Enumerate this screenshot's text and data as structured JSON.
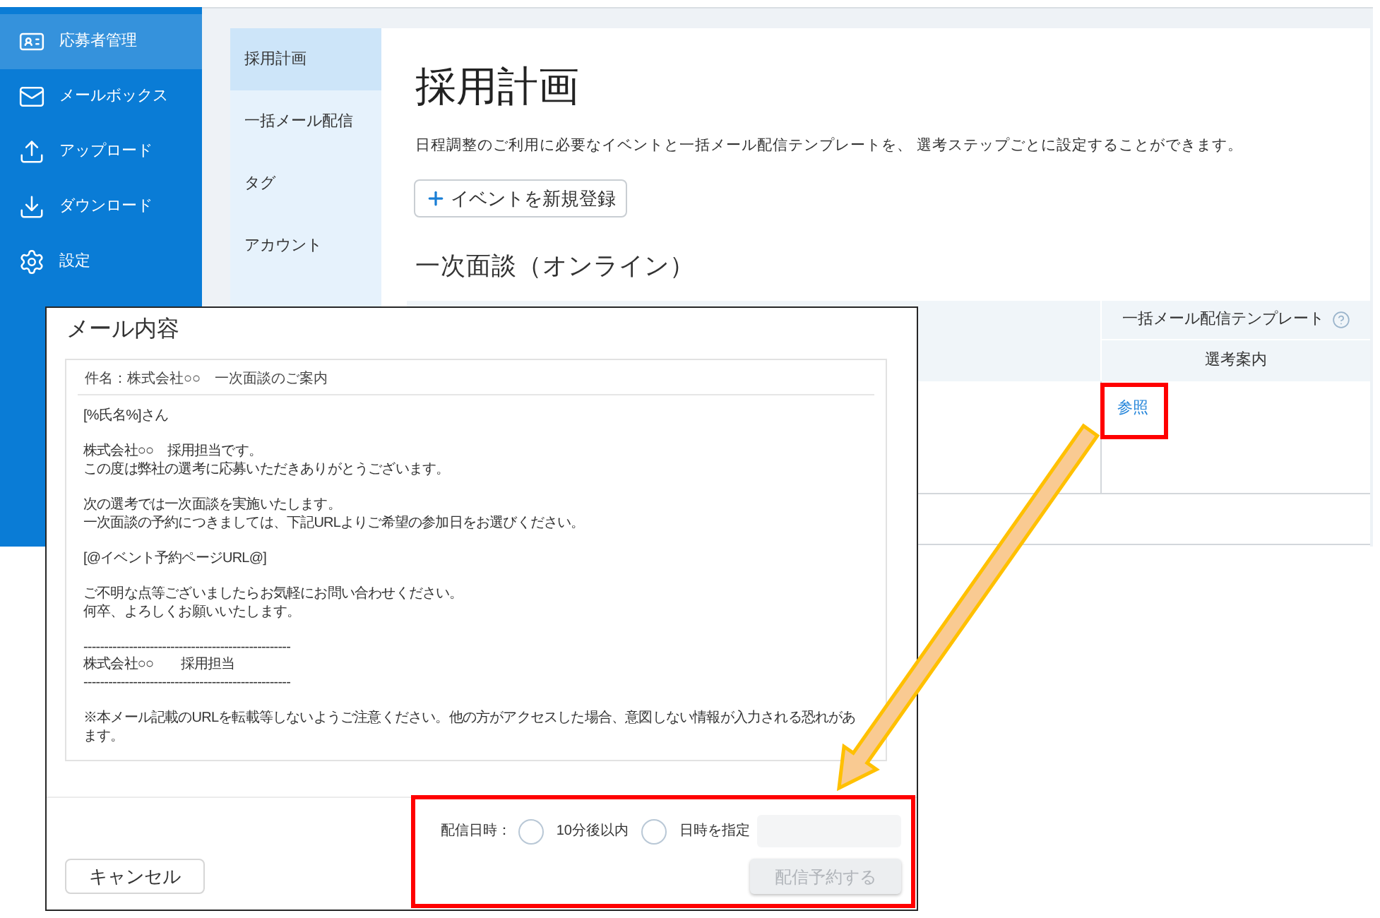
{
  "sidebar": {
    "items": [
      {
        "label": "応募者管理",
        "selected": true
      },
      {
        "label": "メールボックス",
        "selected": false
      },
      {
        "label": "アップロード",
        "selected": false
      },
      {
        "label": "ダウンロード",
        "selected": false
      },
      {
        "label": "設定",
        "selected": false
      }
    ]
  },
  "subnav": {
    "items": [
      {
        "label": "採用計画",
        "selected": true
      },
      {
        "label": "一括メール配信",
        "selected": false
      },
      {
        "label": "タグ",
        "selected": false
      },
      {
        "label": "アカウント",
        "selected": false
      }
    ]
  },
  "page": {
    "title": "採用計画",
    "description": "日程調整のご利用に必要なイベントと一括メール配信テンプレートを、 選考ステップごとに設定することができます。",
    "new_event_button": "イベントを新規登録",
    "section_title": "一次面談（オンライン）",
    "table": {
      "group_header": "一括メール配信テンプレート",
      "column_header": "選考案内",
      "rows": [
        {
          "template_link": "参照"
        }
      ]
    }
  },
  "dialog": {
    "title": "メール内容",
    "subject": "件名：株式会社○○　一次面談のご案内",
    "body": [
      [
        "[%氏名%]さん"
      ],
      [
        "株式会社○○　採用担当です。",
        "この度は弊社の選考に応募いただきありがとうございます。"
      ],
      [
        "次の選考では一次面談を実施いたします。",
        "一次面談の予約につきましては、下記URLよりご希望の参加日をお選びください。"
      ],
      [
        "[@イベント予約ページURL@]"
      ],
      [
        "ご不明な点等ございましたらお気軽にお問い合わせください。",
        "何卒、よろしくお願いいたします。"
      ],
      [
        "--------------------------------------------------",
        "株式会社○○　　採用担当",
        "--------------------------------------------------"
      ],
      [
        "※本メール記載のURLを転載等しないようご注意ください。他の方がアクセスした場合、意図しない情報が入力される恐れがあ",
        "ます。"
      ]
    ],
    "schedule": {
      "label": "配信日時：",
      "options": [
        {
          "label": "10分後以内",
          "selected": false
        },
        {
          "label": "日時を指定",
          "selected": false
        }
      ]
    },
    "schedule_button": {
      "label": "配信予約する",
      "disabled": true
    },
    "cancel_button": "キャンセル"
  }
}
